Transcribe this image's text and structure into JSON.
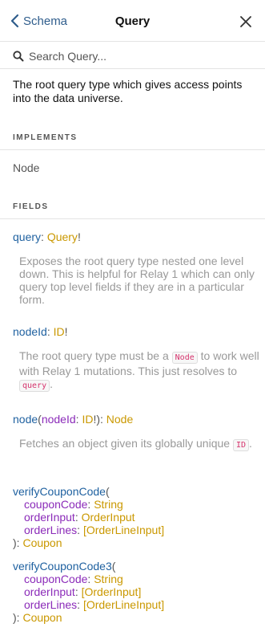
{
  "header": {
    "back_label": "Schema",
    "title": "Query"
  },
  "search": {
    "placeholder": "Search Query..."
  },
  "description": "The root query type which gives access points into the data universe.",
  "implements": {
    "heading": "IMPLEMENTS",
    "items": [
      "Node"
    ]
  },
  "fields": {
    "heading": "FIELDS",
    "query": {
      "name": "query",
      "type": "Query",
      "suffix": "!",
      "description": "Exposes the root query type nested one level down. This is helpful for Relay 1 which can only query top level fields if they are in a particular form."
    },
    "nodeId": {
      "name": "nodeId",
      "type": "ID",
      "suffix": "!",
      "desc_part1": "The root query type must be a ",
      "desc_code1": "Node",
      "desc_part2": " to work well with Relay 1 mutations. This just resolves to ",
      "desc_code2": "query",
      "desc_part3": "."
    },
    "node": {
      "name": "node",
      "arg_name": "nodeId",
      "arg_type": "ID",
      "arg_suffix": "!",
      "type": "Node",
      "desc_part1": "Fetches an object given its globally unique ",
      "desc_code1": "ID",
      "desc_part2": "."
    },
    "verifyCouponCode": {
      "name": "verifyCouponCode",
      "args": [
        {
          "name": "couponCode",
          "type": "String",
          "list": false
        },
        {
          "name": "orderInput",
          "type": "OrderInput",
          "list": false
        },
        {
          "name": "orderLines",
          "type": "OrderLineInput",
          "list": true
        }
      ],
      "type": "Coupon"
    },
    "verifyCouponCode3": {
      "name": "verifyCouponCode3",
      "args": [
        {
          "name": "couponCode",
          "type": "String",
          "list": false
        },
        {
          "name": "orderInput",
          "type": "OrderInput",
          "list": true
        },
        {
          "name": "orderLines",
          "type": "OrderLineInput",
          "list": true
        }
      ],
      "type": "Coupon"
    }
  },
  "colors": {
    "type": "#ca9800",
    "field": "#1f61a0",
    "arg": "#8b2bb9",
    "link": "#2f5d8c"
  }
}
